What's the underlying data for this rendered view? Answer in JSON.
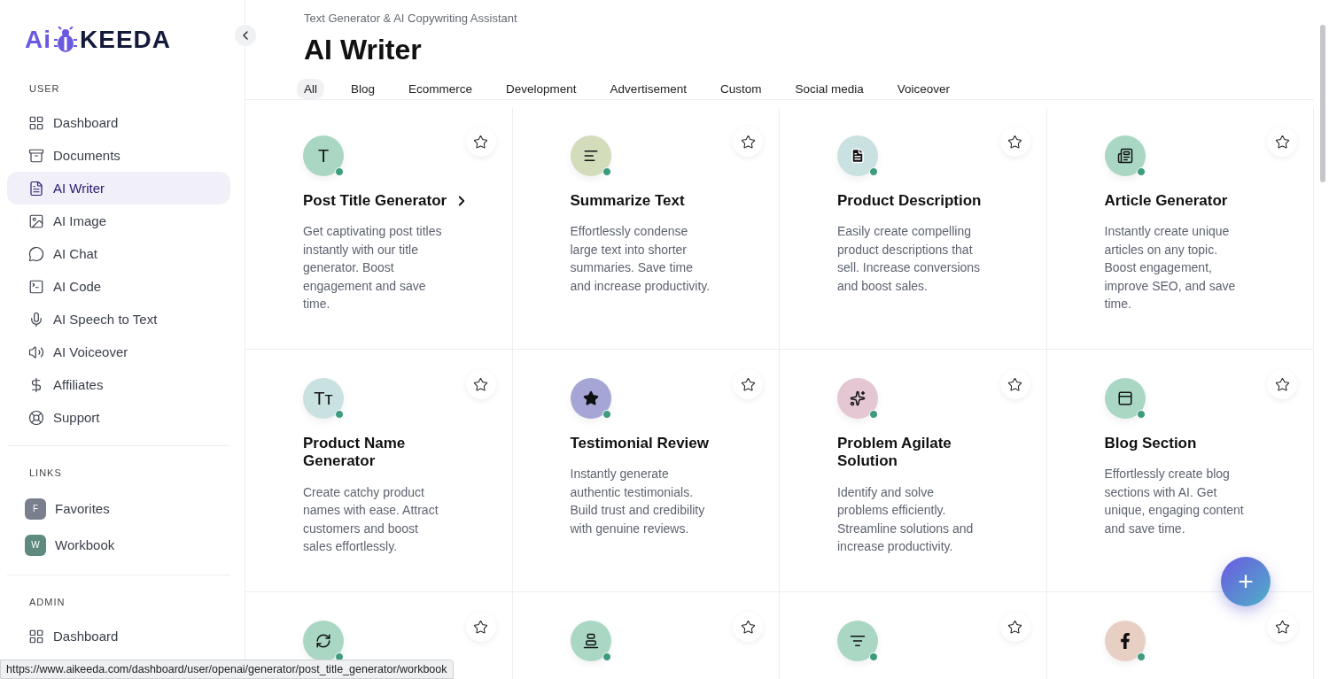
{
  "logo": {
    "lead": "Ai",
    "rest": "KEEDA"
  },
  "sidebar": {
    "sections": [
      {
        "title": "USER",
        "items": [
          {
            "label": "Dashboard",
            "selected": false
          },
          {
            "label": "Documents",
            "selected": false
          },
          {
            "label": "AI Writer",
            "selected": true
          },
          {
            "label": "AI Image",
            "selected": false
          },
          {
            "label": "AI Chat",
            "selected": false
          },
          {
            "label": "AI Code",
            "selected": false
          },
          {
            "label": "AI Speech to Text",
            "selected": false
          },
          {
            "label": "AI Voiceover",
            "selected": false
          },
          {
            "label": "Affiliates",
            "selected": false
          },
          {
            "label": "Support",
            "selected": false
          }
        ]
      },
      {
        "title": "LINKS",
        "links": [
          {
            "initial": "F",
            "label": "Favorites",
            "color": "#7a7f8e"
          },
          {
            "initial": "W",
            "label": "Workbook",
            "color": "#5f8a80"
          }
        ]
      },
      {
        "title": "ADMIN",
        "items": [
          {
            "label": "Dashboard",
            "selected": false
          }
        ]
      }
    ]
  },
  "header": {
    "subtitle": "Text Generator & AI Copywriting Assistant",
    "title": "AI Writer"
  },
  "tabs": [
    {
      "label": "All",
      "selected": true
    },
    {
      "label": "Blog",
      "selected": false
    },
    {
      "label": "Ecommerce",
      "selected": false
    },
    {
      "label": "Development",
      "selected": false
    },
    {
      "label": "Advertisement",
      "selected": false
    },
    {
      "label": "Custom",
      "selected": false
    },
    {
      "label": "Social media",
      "selected": false
    },
    {
      "label": "Voiceover",
      "selected": false
    }
  ],
  "cards": [
    {
      "kind": "letter",
      "glyph": "T",
      "color": "#a9d7c4",
      "title": "Post Title Generator",
      "hovered": true,
      "description": "Get captivating post titles instantly with our title generator. Boost engagement and save time."
    },
    {
      "kind": "icon",
      "color": "#d3dcbb",
      "title": "Summarize Text",
      "hovered": false,
      "description": "Effortlessly condense large text into shorter summaries. Save time and increase productivity."
    },
    {
      "kind": "icon",
      "color": "#c9e1e0",
      "title": "Product Description",
      "hovered": false,
      "description": "Easily create compelling product descriptions that sell. Increase conversions and boost sales."
    },
    {
      "kind": "icon",
      "color": "#a9d7c4",
      "title": "Article Generator",
      "hovered": false,
      "description": "Instantly create unique articles on any topic. Boost engagement, improve SEO, and save time."
    },
    {
      "kind": "letter",
      "glyph": "Tт",
      "color": "#c9e1e0",
      "title": "Product Name Generator",
      "hovered": false,
      "description": "Create catchy product names with ease. Attract customers and boost sales effortlessly."
    },
    {
      "kind": "icon",
      "color": "#a6a6d6",
      "title": "Testimonial Review",
      "hovered": false,
      "description": "Instantly generate authentic testimonials. Build trust and credibility with genuine reviews."
    },
    {
      "kind": "icon",
      "color": "#e5c6d3",
      "title": "Problem Agilate Solution",
      "hovered": false,
      "description": "Identify and solve problems efficiently. Streamline solutions and increase productivity."
    },
    {
      "kind": "icon",
      "color": "#a9d7c4",
      "title": "Blog Section",
      "hovered": false,
      "description": "Effortlessly create blog sections with AI. Get unique, engaging content and save time."
    },
    {
      "kind": "icon",
      "color": "#a9d7c4"
    },
    {
      "kind": "icon",
      "color": "#a9d7c4"
    },
    {
      "kind": "icon",
      "color": "#a9d7c4"
    },
    {
      "kind": "icon",
      "color": "#e8cfc4"
    }
  ],
  "fab": {
    "label": "+"
  },
  "status_url": "https://www.aikeeda.com/dashboard/user/openai/generator/post_title_generator/workbook"
}
